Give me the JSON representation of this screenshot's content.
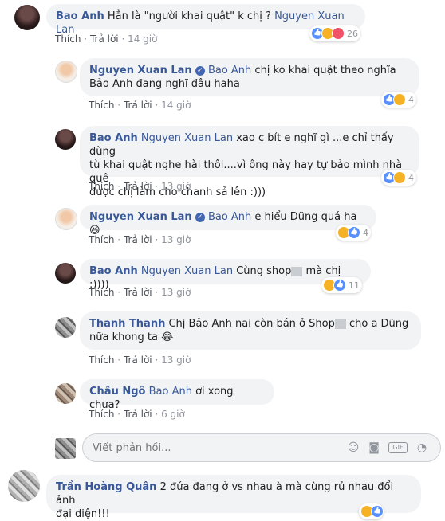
{
  "actions": {
    "like": "Thích",
    "reply": "Trả lời"
  },
  "c1": {
    "author": "Bao Anh",
    "text": "Hẳn là \"người khai quật\" k chị ?",
    "tag": "Nguyen Xuan Lan",
    "time": "14 giờ",
    "reactions": "26"
  },
  "c2": {
    "author": "Nguyen Xuan Lan",
    "tag": "Bao Anh",
    "text": "chị ko khai quật theo nghĩa Bảo Anh đang nghĩ đâu haha",
    "time": "14 giờ",
    "reactions": "4"
  },
  "c3": {
    "author": "Bao Anh",
    "tag": "Nguyen Xuan Lan",
    "text1": "xao c bít e nghĩ gì ...e chỉ thấy dùng",
    "text2": "từ khai quật nghe hài thôi....vì ông này hay tự bảo mình nhà quê",
    "text3": "được chị làm cho chanh sả lên :)))",
    "time": "13 giờ",
    "reactions": "4"
  },
  "c4": {
    "author": "Nguyen Xuan Lan",
    "tag": "Bao Anh",
    "text": "e hiểu Dũng quá ha",
    "time": "13 giờ",
    "reactions": "4"
  },
  "c5": {
    "author": "Bao Anh",
    "tag": "Nguyen Xuan Lan",
    "text_a": "Cùng shop",
    "text_b": "mà chị :))))",
    "time": "13 giờ",
    "reactions": "11"
  },
  "c6": {
    "author": "Thanh Thanh",
    "text_a": "Chị Bảo Anh nai còn bán ở Shop",
    "text_b": "cho a Dũng",
    "text2": "nữa khong ta",
    "time": "13 giờ"
  },
  "c7": {
    "author": "Châu Ngô",
    "tag": "Bao Anh",
    "text": "ơi xong chưa?",
    "time": "6 giờ"
  },
  "reply_input": {
    "placeholder": "Viết phản hồi..."
  },
  "c8": {
    "author": "Trần Hoàng Quân",
    "text1": "2 đứa đang ở vs nhau à mà cùng rủ nhau đổi ảnh",
    "text2": "đại diện!!!"
  }
}
